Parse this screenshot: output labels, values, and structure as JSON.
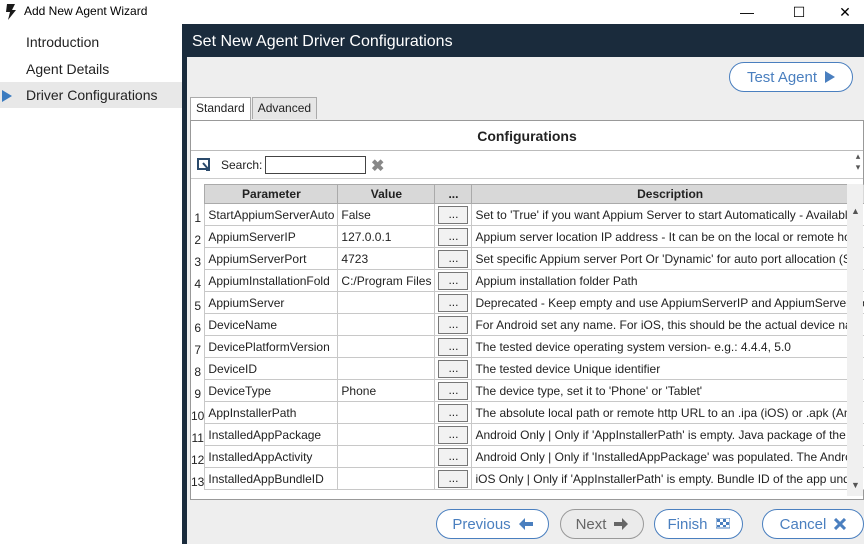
{
  "window": {
    "title": "Add New Agent Wizard",
    "minimize_glyph": "—",
    "maximize_glyph": "☐",
    "close_glyph": "✕"
  },
  "sidebar": {
    "items": [
      {
        "label": "Introduction"
      },
      {
        "label": "Agent Details"
      },
      {
        "label": "Driver Configurations",
        "active": true
      }
    ]
  },
  "main": {
    "header": "Set New Agent Driver Configurations",
    "test_agent_label": "Test Agent",
    "tabs": [
      {
        "label": "Standard",
        "active": true
      },
      {
        "label": "Advanced"
      }
    ]
  },
  "grid": {
    "title": "Configurations",
    "search_label": "Search:",
    "search_value": "",
    "columns": [
      "Parameter",
      "Value",
      "...",
      "Description"
    ],
    "button_label": "...",
    "rows": [
      {
        "num": "1",
        "parameter": "StartAppiumServerAuto",
        "value": "False",
        "description": "Set to 'True' if you want Appium Server to start Automatically - Available"
      },
      {
        "num": "2",
        "parameter": "AppiumServerIP",
        "value": "127.0.0.1",
        "description": "Appium server location IP address - It can be on the local or remote hos"
      },
      {
        "num": "3",
        "parameter": "AppiumServerPort",
        "value": "4723",
        "description": "Set specific Appium server Port Or 'Dynamic' for auto port allocation (Sta"
      },
      {
        "num": "4",
        "parameter": "AppiumInstallationFold",
        "value": "C:/Program Files",
        "description": "Appium installation folder Path"
      },
      {
        "num": "5",
        "parameter": "AppiumServer",
        "value": "",
        "description": "Deprecated - Keep empty and use AppiumServerIP and AppiumServerPo"
      },
      {
        "num": "6",
        "parameter": "DeviceName",
        "value": "",
        "description": "For Android set any name. For iOS, this should be the actual device nam"
      },
      {
        "num": "7",
        "parameter": "DevicePlatformVersion",
        "value": "",
        "description": "The tested device operating system version- e.g.: 4.4.4, 5.0"
      },
      {
        "num": "8",
        "parameter": "DeviceID",
        "value": "",
        "description": "The tested device Unique identifier"
      },
      {
        "num": "9",
        "parameter": "DeviceType",
        "value": "Phone",
        "description": "The device type, set it to 'Phone' or 'Tablet'"
      },
      {
        "num": "10",
        "parameter": "AppInstallerPath",
        "value": "",
        "description": "The absolute local path or remote http URL to an .ipa (iOS) or .apk (Andr"
      },
      {
        "num": "11",
        "parameter": "InstalledAppPackage",
        "value": "",
        "description": "Android Only | Only if 'AppInstallerPath' is empty. Java package of the A"
      },
      {
        "num": "12",
        "parameter": "InstalledAppActivity",
        "value": "",
        "description": "Android Only | Only if 'InstalledAppPackage' was populated. The Androi"
      },
      {
        "num": "13",
        "parameter": "InstalledAppBundleID",
        "value": "",
        "description": "iOS Only | Only if 'AppInstallerPath' is empty. Bundle ID of the app unde"
      }
    ]
  },
  "footer": {
    "previous_label": "Previous",
    "next_label": "Next",
    "finish_label": "Finish",
    "cancel_label": "Cancel"
  },
  "colors": {
    "accent": "#4a7fbf",
    "header_bg": "#1a2b3c",
    "nav_arrow": "#3a7bc0"
  }
}
